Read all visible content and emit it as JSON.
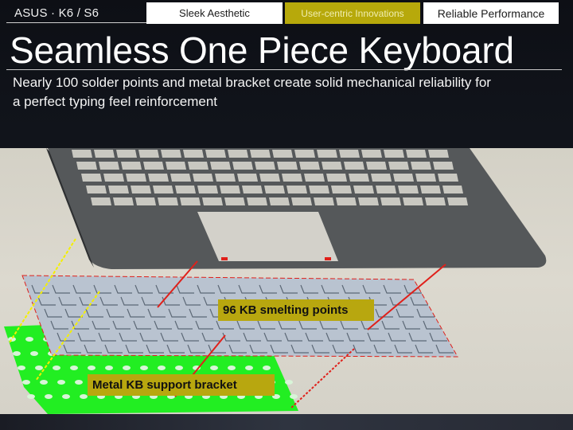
{
  "header": {
    "brand": "ASUS · K6 / S6",
    "tabs": [
      {
        "label": "Sleek Aesthetic",
        "active": false
      },
      {
        "label": "User-centric Innovations",
        "active": true
      },
      {
        "label": "Reliable Performance",
        "active": false
      }
    ]
  },
  "slide": {
    "title": "Seamless One Piece Keyboard",
    "description_line1": "Nearly 100 solder points and metal bracket create solid mechanical reliability for",
    "description_line2": "a perfect typing feel reinforcement"
  },
  "figure": {
    "callouts": [
      {
        "label": "96 KB smelting points"
      },
      {
        "label": "Metal KB support bracket"
      }
    ],
    "colors": {
      "accent": "#b8a70f",
      "bracket": "#22ee22",
      "palmrest": "#55585a",
      "keyboard_plate": "#b9c3d0",
      "arrow_red": "#e0201a",
      "arrow_yellow": "#f4f000"
    }
  }
}
